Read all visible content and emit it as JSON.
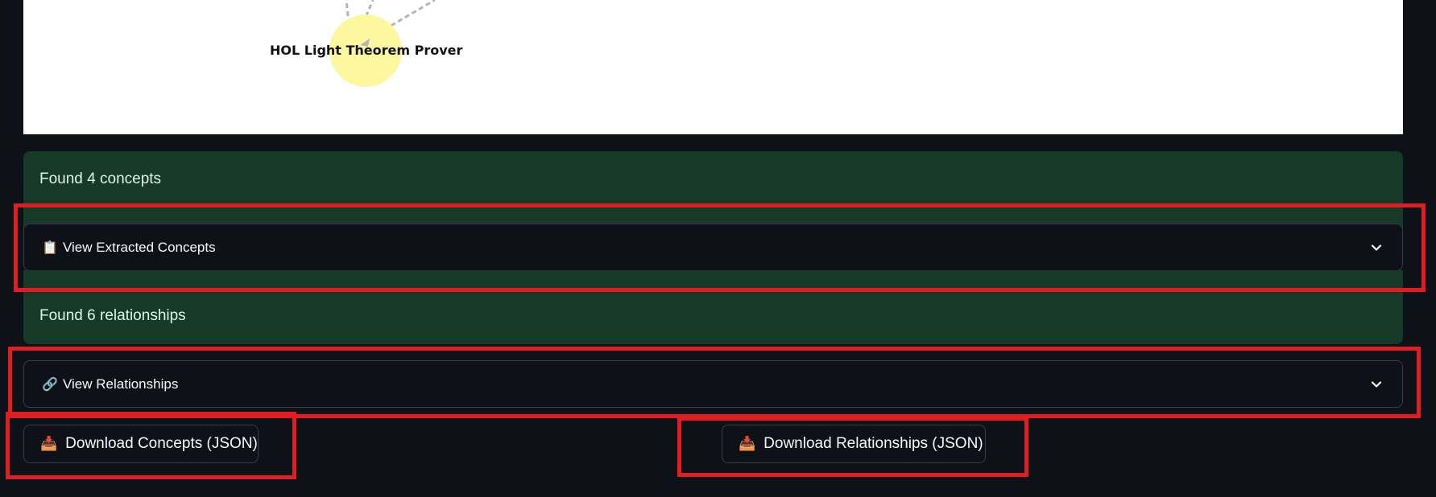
{
  "graph": {
    "node_label": "HOL Light Theorem Prover",
    "node_color": "#fdf7a0",
    "edge_color": "#b5b5b5"
  },
  "concepts_status": "Found 4 concepts",
  "concepts_expander": {
    "icon": "clipboard-icon",
    "icon_glyph": "📋",
    "label": "View Extracted Concepts"
  },
  "relationships_status": "Found 6 relationships",
  "relationships_expander": {
    "icon": "link-icon",
    "icon_glyph": "🔗",
    "label": "View Relationships"
  },
  "download_concepts": {
    "icon": "inbox-tray-icon",
    "icon_glyph": "📥",
    "label": "Download Concepts (JSON)"
  },
  "download_relationships": {
    "icon": "inbox-tray-icon",
    "icon_glyph": "📥",
    "label": "Download Relationships (JSON)"
  },
  "colors": {
    "background": "#0e1117",
    "success_box": "#173928",
    "highlight_border": "#e01e22"
  }
}
